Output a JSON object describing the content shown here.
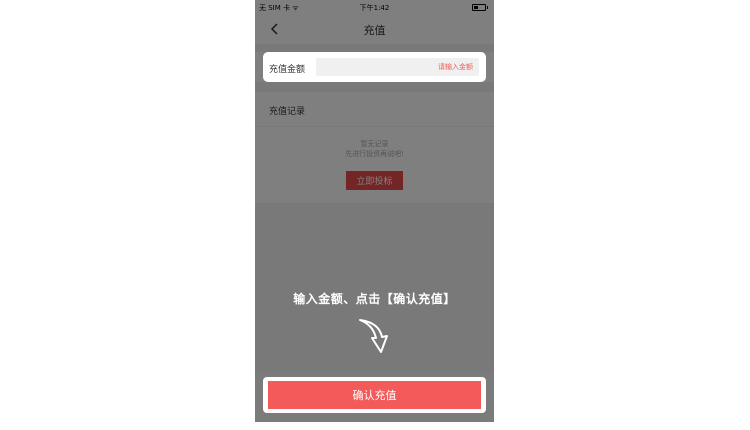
{
  "statusbar": {
    "carrier": "无 SIM 卡 ᯤ",
    "time": "下午1:42"
  },
  "navbar": {
    "title": "充值"
  },
  "amount": {
    "label": "充值金额",
    "placeholder": "请输入金额"
  },
  "records": {
    "title": "充值记录",
    "empty_line1": "暂无记录",
    "empty_line2": "先进行投资再说吧!",
    "bid_button": "立即投标"
  },
  "tip": {
    "text": "输入金额、点击【确认充值】"
  },
  "confirm": {
    "label": "确认充值"
  },
  "colors": {
    "accent": "#f35a5a",
    "overlay": "rgba(0,0,0,0.5)"
  },
  "icons": {
    "back": "chevron-left-icon",
    "battery": "battery-icon",
    "arrow": "curved-arrow-down-icon"
  }
}
